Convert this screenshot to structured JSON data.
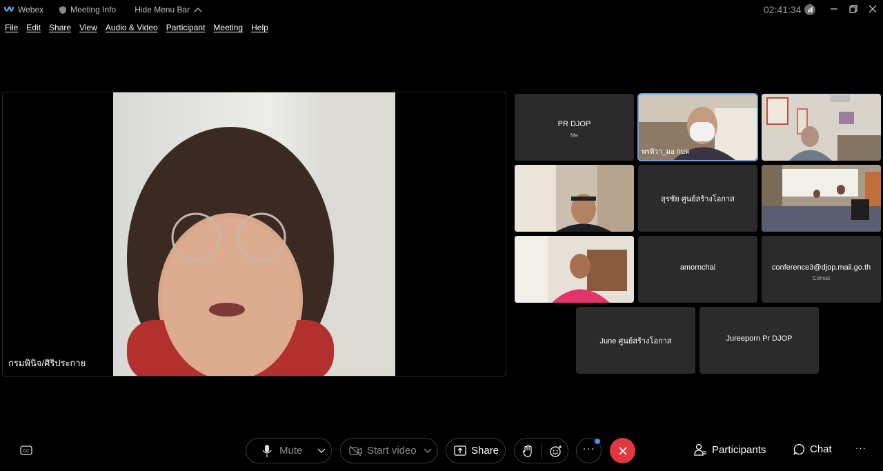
{
  "titlebar": {
    "app_name": "Webex",
    "meeting_info": "Meeting Info",
    "hide_menu": "Hide Menu Bar",
    "clock": "02:41:34"
  },
  "menu": {
    "items": [
      "File",
      "Edit",
      "Share",
      "View",
      "Audio & Video",
      "Participant",
      "Meeting",
      "Help"
    ]
  },
  "stage": {
    "speaker_name": "กรมพินิจ/ศิริประกาย"
  },
  "tiles": [
    {
      "name": "PR DJOP",
      "sub": "Me",
      "video": false
    },
    {
      "name": "พรทิวา_มอ กบด",
      "video": true
    },
    {
      "name": "",
      "video": true
    },
    {
      "name": "",
      "video": true
    },
    {
      "name": "สุรชัย ศูนย์สร้างโอกาส",
      "video": false
    },
    {
      "name": "",
      "video": true
    },
    {
      "name": "",
      "video": true
    },
    {
      "name": "amornchai",
      "video": false
    },
    {
      "name": "conference3@djop.mail.go.th",
      "sub": "Cohost",
      "video": false
    },
    {
      "name": "June ศูนย์สร้างโอกาส",
      "video": false
    },
    {
      "name": "Jureeporn Pr DJOP",
      "video": false
    }
  ],
  "toolbar": {
    "mute": "Mute",
    "start_video": "Start video",
    "share": "Share",
    "participants": "Participants",
    "chat": "Chat",
    "more": "···"
  },
  "colors": {
    "end_call": "#e0383e",
    "active_border": "#6aa3e6",
    "tile_bg": "#2b2b2b",
    "notify_dot": "#4a90e2"
  }
}
